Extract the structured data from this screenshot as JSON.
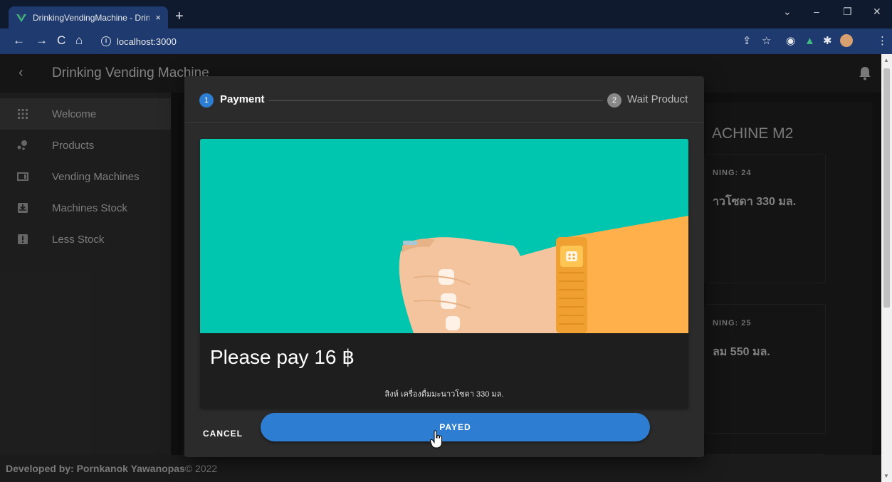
{
  "browser": {
    "tab_title": "DrinkingVendingMachine - Drink",
    "tab_close": "×",
    "new_tab": "+",
    "url": "localhost:3000",
    "window_controls": [
      "⌄",
      "–",
      "❐",
      "✕"
    ]
  },
  "appbar": {
    "back": "‹",
    "title": "Drinking Vending Machine"
  },
  "sidebar": {
    "items": [
      {
        "label": "Welcome",
        "icon": "grid-icon",
        "active": true
      },
      {
        "label": "Products",
        "icon": "bubbles-icon",
        "active": false
      },
      {
        "label": "Vending Machines",
        "icon": "machine-icon",
        "active": false
      },
      {
        "label": "Machines Stock",
        "icon": "inbox-download-icon",
        "active": false
      },
      {
        "label": "Less Stock",
        "icon": "alert-box-icon",
        "active": false
      }
    ]
  },
  "content": {
    "machine_title": "ACHINE M2",
    "cards": [
      {
        "remaining": "NING: 24",
        "name": "าวโซดา 330 มล."
      },
      {
        "remaining": "NING: 25",
        "name": "ลม 550 มล."
      }
    ]
  },
  "footer": {
    "developed_by": "Developed by: Pornkanok Yawanopas",
    "copyright": "© 2022"
  },
  "dialog": {
    "steps": [
      {
        "number": "1",
        "label": "Payment",
        "active": true
      },
      {
        "number": "2",
        "label": "Wait Product",
        "active": false
      }
    ],
    "pay_text": "Please pay 16 ฿",
    "product_name": "สิงห์ เครื่องดื่มมะนาวโซดา 330 มล.",
    "cancel_label": "CANCEL",
    "payed_label": "PAYED"
  },
  "colors": {
    "accent": "#2d7dd2",
    "media_bg": "#00c5af",
    "step_active": "#2d7dd2"
  }
}
